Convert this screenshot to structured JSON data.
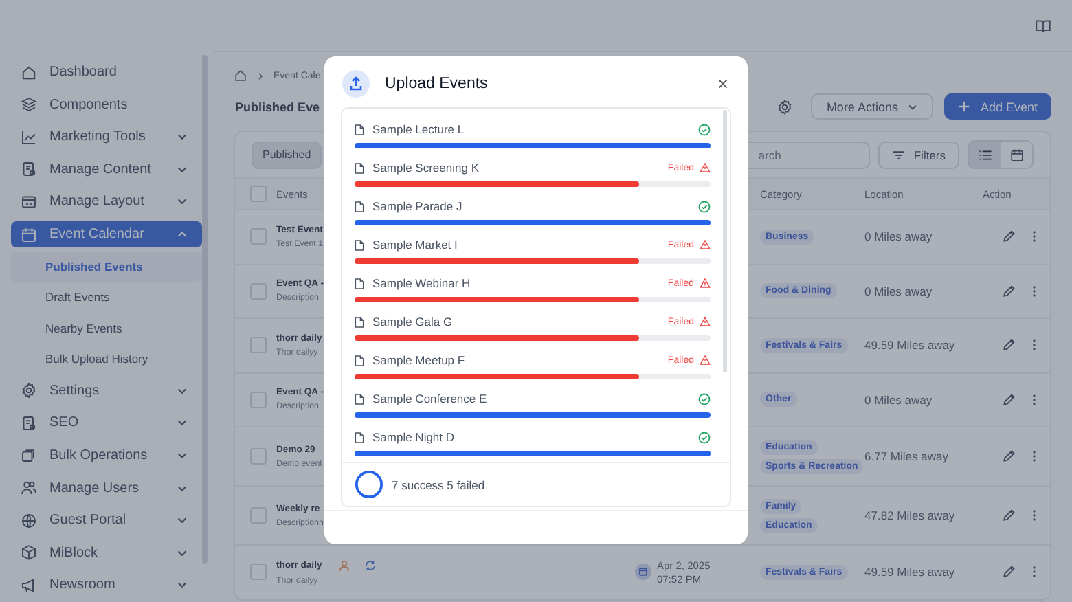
{
  "sidebar": {
    "items": [
      {
        "label": "Dashboard",
        "selected": false
      },
      {
        "label": "Components",
        "selected": false
      },
      {
        "label": "Marketing Tools",
        "expanded": false,
        "selected": false
      },
      {
        "label": "Manage Content",
        "expanded": false,
        "selected": false
      },
      {
        "label": "Manage Layout",
        "expanded": false,
        "selected": false
      },
      {
        "label": "Event Calendar",
        "expanded": true,
        "selected": true,
        "children": [
          {
            "label": "Published Events",
            "selected": true
          },
          {
            "label": "Draft Events",
            "selected": false
          },
          {
            "label": "Nearby Events",
            "selected": false
          },
          {
            "label": "Bulk Upload History",
            "selected": false
          }
        ]
      },
      {
        "label": "Settings",
        "expanded": false,
        "selected": false
      },
      {
        "label": "SEO",
        "expanded": false,
        "selected": false
      },
      {
        "label": "Bulk Operations",
        "expanded": false,
        "selected": false
      },
      {
        "label": "Manage Users",
        "expanded": false,
        "selected": false
      },
      {
        "label": "Guest Portal",
        "expanded": false,
        "selected": false
      },
      {
        "label": "MiBlock",
        "expanded": false,
        "selected": false
      },
      {
        "label": "Newsroom",
        "expanded": false,
        "selected": false
      }
    ]
  },
  "breadcrumb": [
    "Event Cale"
  ],
  "page_title": "Published Eve",
  "header_buttons": {
    "more_actions": "More Actions",
    "add_event": "Add Event"
  },
  "toolbar": {
    "tabs": [
      {
        "label": "Published",
        "selected": true
      }
    ],
    "search": {
      "placeholder": "arch"
    },
    "filters": "Filters",
    "views": [
      {
        "kind": "list",
        "selected": true
      },
      {
        "kind": "calendar",
        "selected": false
      }
    ]
  },
  "table": {
    "columns": [
      "Events",
      "Category",
      "Location",
      "Action"
    ],
    "all_checked": false,
    "rows": [
      {
        "checked": false,
        "title": "Test Event",
        "description": "Test Event 1",
        "categories": [
          "Business"
        ],
        "location": "0 Miles away"
      },
      {
        "checked": false,
        "title": "Event QA -",
        "description": "Description",
        "categories": [
          "Food & Dining"
        ],
        "location": "0 Miles away"
      },
      {
        "checked": false,
        "title": "thorr daily",
        "description": "Thor dailyy",
        "categories": [
          "Festivals & Fairs"
        ],
        "location": "49.59 Miles away"
      },
      {
        "checked": false,
        "title": "Event QA -",
        "description": "Description",
        "categories": [
          "Other"
        ],
        "location": "0 Miles away"
      },
      {
        "checked": false,
        "title": "Demo 29",
        "description": "Demo event",
        "categories": [
          "Education",
          "Sports & Recreation"
        ],
        "location": "6.77 Miles away"
      },
      {
        "checked": false,
        "title": "Weekly re",
        "description": "Descriptionn",
        "categories": [
          "Family",
          "Education"
        ],
        "location": "47.82 Miles away"
      },
      {
        "checked": false,
        "title": "thorr daily",
        "description": "Thor dailyy",
        "date": "Apr 2, 2025",
        "time": "07:52 PM",
        "categories": [
          "Festivals & Fairs"
        ],
        "location": "49.59 Miles away"
      }
    ]
  },
  "modal": {
    "title": "Upload Events",
    "files": [
      {
        "name": "Sample Lecture L",
        "kind": "success",
        "level": 1
      },
      {
        "name": "Sample Screening K",
        "kind": "failed",
        "status": "Failed",
        "level": 0.8
      },
      {
        "name": "Sample Parade J",
        "kind": "success",
        "level": 1
      },
      {
        "name": "Sample Market I",
        "kind": "failed",
        "status": "Failed",
        "level": 0.8
      },
      {
        "name": "Sample Webinar H",
        "kind": "failed",
        "status": "Failed",
        "level": 0.8
      },
      {
        "name": "Sample Gala G",
        "kind": "failed",
        "status": "Failed",
        "level": 0.8
      },
      {
        "name": "Sample Meetup F",
        "kind": "failed",
        "status": "Failed",
        "level": 0.8
      },
      {
        "name": "Sample Conference E",
        "kind": "success",
        "level": 1
      },
      {
        "name": "Sample Night D",
        "kind": "success",
        "level": 1
      }
    ],
    "summary": "7 success 5 failed"
  }
}
